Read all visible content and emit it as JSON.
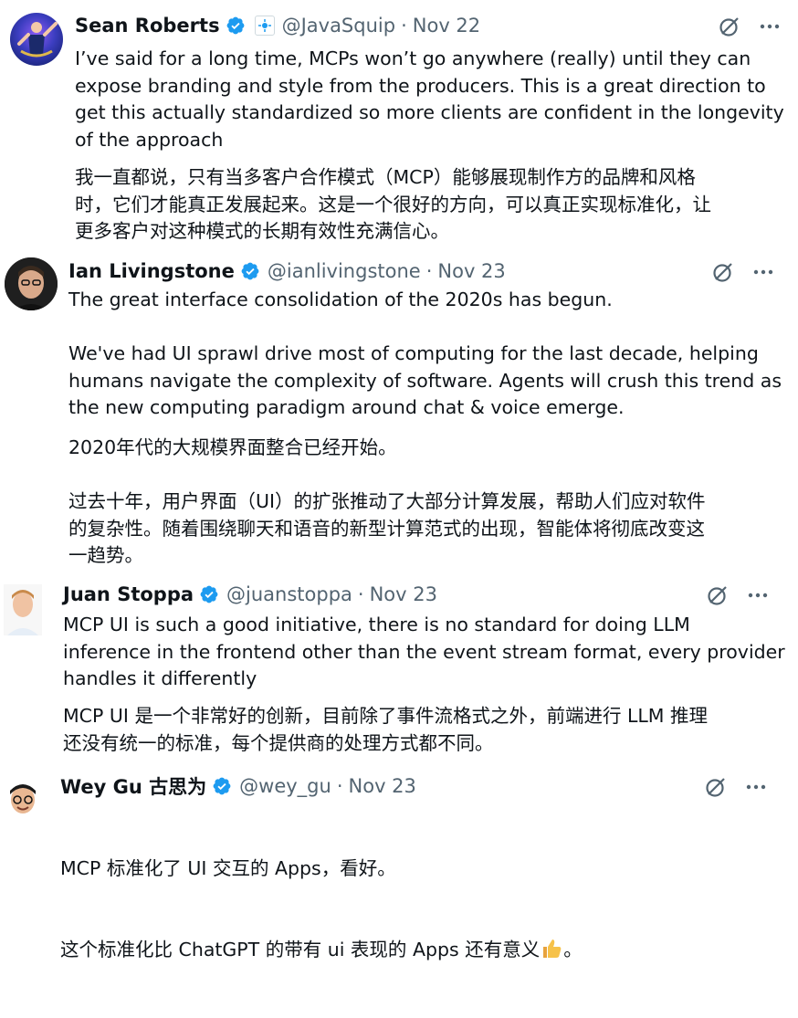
{
  "tweets": [
    {
      "author": "Sean Roberts",
      "handle": "@JavaSquip",
      "date": "Nov 22",
      "text_en": "I’ve said for a long time, MCPs won’t go anywhere (really) until they can\nexpose branding and style from the producers. This is a great direction to\nget this actually standardized so more clients are confident in the longevity\nof the approach",
      "text_zh": "我一直都说，只有当多客户合作模式（MCP）能够展现制作方的品牌和风格\n时，它们才能真正发展起来。这是一个很好的方向，可以真正实现标准化，让\n更多客户对这种模式的长期有效性充满信心。"
    },
    {
      "author": "Ian Livingstone",
      "handle": "@ianlivingstone",
      "date": "Nov 23",
      "text_en": "The great interface consolidation of the 2020s has begun.\n\nWe've had UI sprawl drive most of computing for the last decade, helping\nhumans navigate the complexity of software. Agents will crush this trend as\nthe new computing paradigm around chat & voice emerge.",
      "text_zh": "2020年代的大规模界面整合已经开始。\n\n过去十年，用户界面（UI）的扩张推动了大部分计算发展，帮助人们应对软件\n的复杂性。随着围绕聊天和语音的新型计算范式的出现，智能体将彻底改变这\n一趋势。"
    },
    {
      "author": "Juan Stoppa",
      "handle": "@juanstoppa",
      "date": "Nov 23",
      "text_en": "MCP UI is such a good initiative, there is no standard for doing LLM\ninference in the frontend other than the event stream format, every provider\nhandles it differently",
      "text_zh": "MCP UI 是一个非常好的创新，目前除了事件流格式之外，前端进行 LLM 推理\n还没有统一的标准，每个提供商的处理方式都不同。"
    },
    {
      "author": "Wey Gu 古思为",
      "handle": "@wey_gu",
      "date": "Nov 23",
      "text_zh_1": "MCP 标准化了 UI 交互的 Apps，看好。",
      "text_zh_2": "这个标准化比 ChatGPT 的带有 ui 表现的 Apps 还有意义",
      "text_zh_2_end": "。"
    }
  ],
  "icons": {
    "verified": "verified-badge-icon",
    "grok": "grok-icon",
    "more": "more-icon",
    "thumbs_up": "thumbs-up-emoji"
  },
  "colors": {
    "verified_blue": "#1d9bf0",
    "secondary_text": "#536471",
    "primary_text": "#0f1419"
  },
  "dot_separator": "·"
}
